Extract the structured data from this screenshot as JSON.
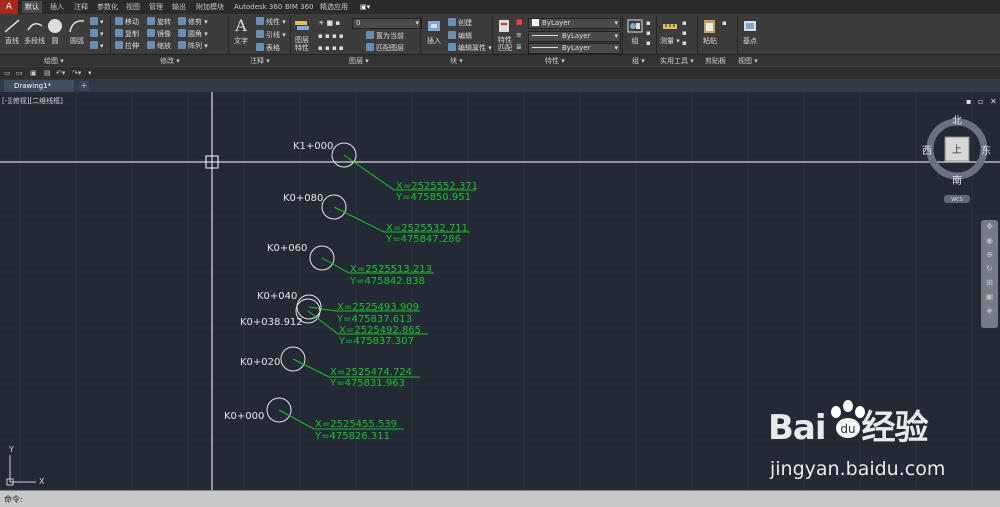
{
  "ribbon_tabs": [
    "默认",
    "插入",
    "注释",
    "参数化",
    "视图",
    "管理",
    "输出",
    "附加模块",
    "Autodesk 360",
    "BIM 360",
    "精选应用"
  ],
  "panels": {
    "draw": {
      "label": "绘图 ▾",
      "tools": [
        "直线",
        "多段线",
        "圆",
        "圆弧"
      ]
    },
    "modify": {
      "label": "修改 ▾",
      "tools": [
        "移动",
        "旋转",
        "修剪",
        "复制",
        "镜像",
        "圆角",
        "拉伸",
        "缩放",
        "阵列"
      ]
    },
    "annotate": {
      "label": "注释 ▾",
      "tools": [
        "文字",
        "线性",
        "引线",
        "表格"
      ]
    },
    "layers": {
      "label": "图层 ▾",
      "tools": [
        "图层特性",
        "置为当前",
        "匹配图层"
      ],
      "current_layer": "0"
    },
    "block": {
      "label": "块 ▾",
      "tools": [
        "插入",
        "创建",
        "编辑",
        "编辑属性"
      ]
    },
    "properties": {
      "label": "特性 ▾",
      "tools": [
        "特性匹配"
      ],
      "color": "ByLayer",
      "linetype": "ByLayer",
      "lineweight": "ByLayer"
    },
    "groups": {
      "label": "组 ▾",
      "tools": [
        "组"
      ]
    },
    "utilities": {
      "label": "实用工具 ▾",
      "tools": [
        "测量"
      ]
    },
    "clipboard": {
      "label": "剪贴板",
      "tools": [
        "粘贴"
      ]
    },
    "view": {
      "label": "视图 ▾",
      "tools": [
        "基点"
      ]
    }
  },
  "document_tab": "Drawing1*",
  "add_tab": "+",
  "viewport_label": "[-][俯视][二维线框]",
  "viewport_controls": [
    "▪",
    "▫",
    "✕"
  ],
  "viewcube": {
    "north": "北",
    "south": "南",
    "east": "东",
    "west": "西",
    "face": "上",
    "wcs": "WCS"
  },
  "ucs": {
    "x": "X",
    "y": "Y"
  },
  "command_prompt": "命令:",
  "watermark": {
    "brand": "Bai",
    "brand2": "经验",
    "url": "jingyan.baidu.com"
  },
  "stations": [
    {
      "name": "K1+000",
      "x": "X=2525552.371",
      "y": "Y=475850.951"
    },
    {
      "name": "K0+080",
      "x": "X=2525532.711",
      "y": "Y=475847.286"
    },
    {
      "name": "K0+060",
      "x": "X=2525513.213",
      "y": "Y=475842.838"
    },
    {
      "name": "K0+040",
      "x": "X=2525493.909",
      "y": "Y=475837.613"
    },
    {
      "name": "K0+038.912",
      "x": "X=2525492.865",
      "y": "Y=475837.307"
    },
    {
      "name": "K0+020",
      "x": "X=2525474.724",
      "y": "Y=475831.963"
    },
    {
      "name": "K0+000",
      "x": "X=2525455.539",
      "y": "Y=475826.311"
    }
  ],
  "colors": {
    "canvas": "#232a36",
    "grid": "#2e3643",
    "leader": "#19c42a",
    "text": "#e6e6e6",
    "crosshair": "#ffffff"
  }
}
